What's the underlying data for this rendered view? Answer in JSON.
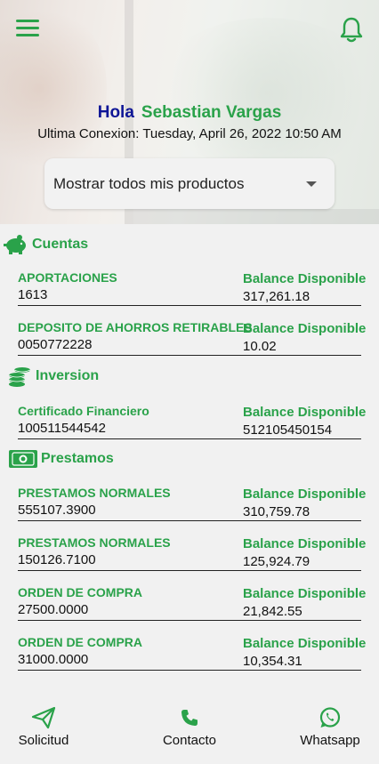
{
  "header": {
    "greeting": "Hola",
    "user_name": "Sebastian Vargas",
    "last_connection": "Ultima Conexion: Tuesday, April 26, 2022 10:50 AM",
    "menu_icon": "hamburger-menu-icon",
    "notification_icon": "bell-icon"
  },
  "product_filter": {
    "selected": "Mostrar todos mis productos"
  },
  "sections": {
    "cuentas": {
      "title": "Cuentas",
      "icon": "piggy-bank-icon",
      "rows": [
        {
          "name": "APORTACIONES",
          "number": "1613",
          "balance_label": "Balance Disponible",
          "balance": "317,261.18"
        },
        {
          "name": "DEPOSITO DE AHORROS RETIRABLES",
          "number": "0050772228",
          "balance_label": "Balance Disponible",
          "balance": "10.02"
        }
      ]
    },
    "inversion": {
      "title": "Inversion",
      "icon": "coins-stack-icon",
      "rows": [
        {
          "name": "Certificado Financiero",
          "number": "100511544542",
          "balance_label": "Balance Disponible",
          "balance": "512105450154"
        }
      ]
    },
    "prestamos": {
      "title": "Prestamos",
      "icon": "money-bill-icon",
      "rows": [
        {
          "name": "PRESTAMOS NORMALES",
          "number": "555107.3900",
          "balance_label": "Balance Disponible",
          "balance": "310,759.78"
        },
        {
          "name": "PRESTAMOS NORMALES",
          "number": "150126.7100",
          "balance_label": "Balance Disponible",
          "balance": "125,924.79"
        },
        {
          "name": "ORDEN DE COMPRA",
          "number": "27500.0000",
          "balance_label": "Balance Disponible",
          "balance": "21,842.55"
        },
        {
          "name": "ORDEN DE COMPRA",
          "number": "31000.0000",
          "balance_label": "Balance Disponible",
          "balance": "10,354.31"
        }
      ]
    }
  },
  "bottom_nav": [
    {
      "label": "Solicitud",
      "icon": "paper-plane-icon"
    },
    {
      "label": "Contacto",
      "icon": "phone-icon"
    },
    {
      "label": "Whatsapp",
      "icon": "whatsapp-icon"
    }
  ],
  "colors": {
    "accent_green": "#2aa24a",
    "greeting_blue": "#0f1696",
    "background": "#f1f1f1"
  }
}
